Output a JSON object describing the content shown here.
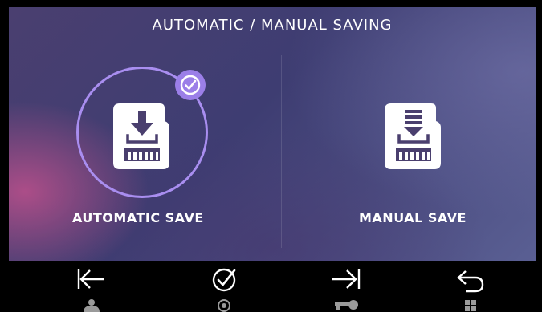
{
  "header": {
    "title": "AUTOMATIC / MANUAL SAVING"
  },
  "options": [
    {
      "label": "AUTOMATIC SAVE",
      "selected": true,
      "icon": "sd-card-download-icon"
    },
    {
      "label": "MANUAL SAVE",
      "selected": false,
      "icon": "sd-card-download-list-icon"
    }
  ],
  "footer": {
    "buttons": [
      {
        "icon": "arrow-left-bar-icon",
        "sub_icon": "person-icon"
      },
      {
        "icon": "check-circle-icon",
        "sub_icon": "circle-dot-icon"
      },
      {
        "icon": "arrow-right-bar-icon",
        "sub_icon": "key-icon"
      },
      {
        "icon": "back-arrow-icon",
        "sub_icon": "grid-icon"
      }
    ]
  },
  "colors": {
    "accent": "#9b7fe8",
    "ring": "#a98ef0",
    "text": "#ffffff",
    "footer_background": "#000000",
    "footer_icon": "#ffffff",
    "footer_sub_icon": "#9a9a9a"
  }
}
